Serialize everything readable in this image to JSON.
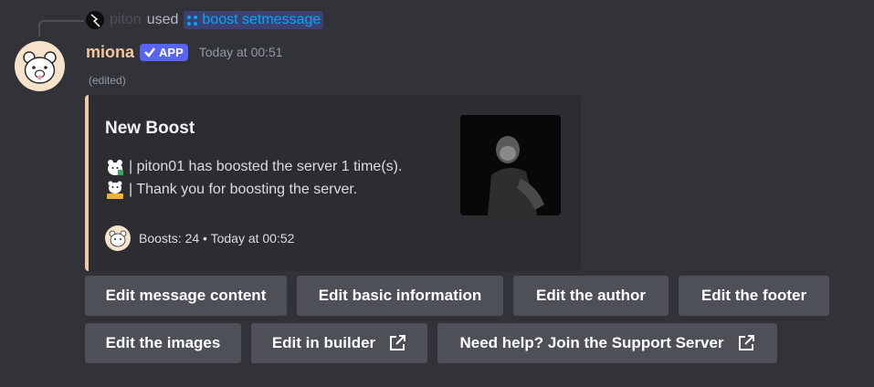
{
  "reply": {
    "user": "piton",
    "used_text": "used",
    "command": "boost setmessage"
  },
  "message": {
    "author": "miona",
    "badge": "APP",
    "timestamp": "Today at 00:51",
    "edited": "(edited)"
  },
  "embed": {
    "accent_color": "#f2c8a0",
    "title": "New Boost",
    "lines": [
      "| piton01 has boosted the server 1 time(s).",
      "| Thank you for boosting the server."
    ],
    "footer": "Boosts: 24 • Today at 00:52"
  },
  "buttons": {
    "edit_message_content": "Edit message content",
    "edit_basic_information": "Edit basic information",
    "edit_author": "Edit the author",
    "edit_footer": "Edit the footer",
    "edit_images": "Edit the images",
    "edit_in_builder": "Edit in builder",
    "support": "Need help? Join the Support Server"
  }
}
